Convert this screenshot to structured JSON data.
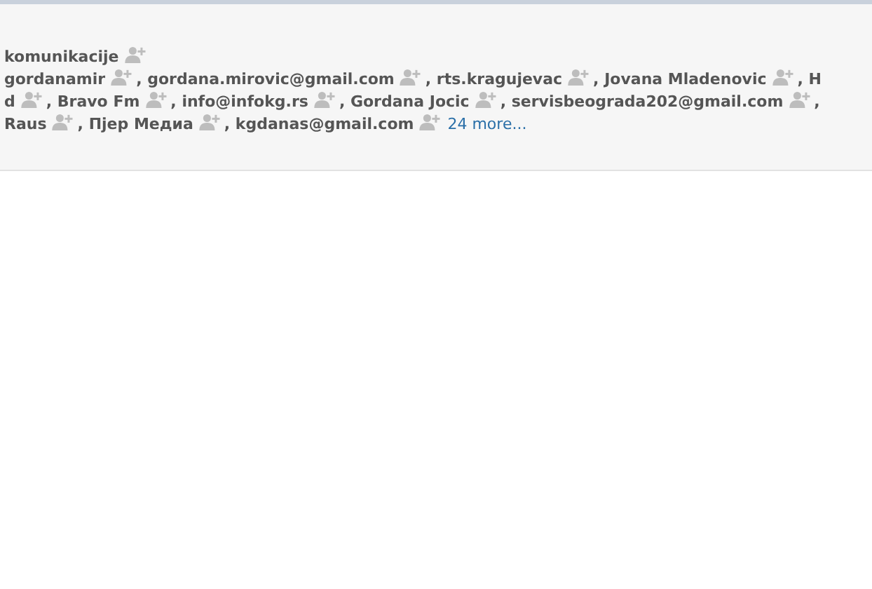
{
  "recipient_lines": [
    {
      "recipients": [
        {
          "name": "komunikacije",
          "add_icon": true
        }
      ]
    },
    {
      "recipients": [
        {
          "name": "gordanamir",
          "add_icon": true,
          "separator": ","
        },
        {
          "name": "gordana.mirovic@gmail.com",
          "add_icon": true,
          "separator": ","
        },
        {
          "name": "rts.kragujevac",
          "add_icon": true,
          "separator": ","
        },
        {
          "name": "Jovana Mladenovic",
          "add_icon": true,
          "separator": ","
        },
        {
          "name": "H",
          "add_icon": false
        }
      ]
    },
    {
      "recipients": [
        {
          "name": "d",
          "add_icon": true,
          "separator": ","
        },
        {
          "name": "Bravo Fm",
          "add_icon": true,
          "separator": ","
        },
        {
          "name": "info@infokg.rs",
          "add_icon": true,
          "separator": ","
        },
        {
          "name": "Gordana Jocic",
          "add_icon": true,
          "separator": ","
        },
        {
          "name": "servisbeograda202@gmail.com",
          "add_icon": true,
          "separator": ","
        }
      ]
    },
    {
      "recipients": [
        {
          "name": "Raus",
          "add_icon": true,
          "separator": ","
        },
        {
          "name": "Пјер Медиа",
          "add_icon": true,
          "separator": ","
        },
        {
          "name": "kgdanas@gmail.com",
          "add_icon": true
        }
      ],
      "more_link": "24 more..."
    }
  ]
}
